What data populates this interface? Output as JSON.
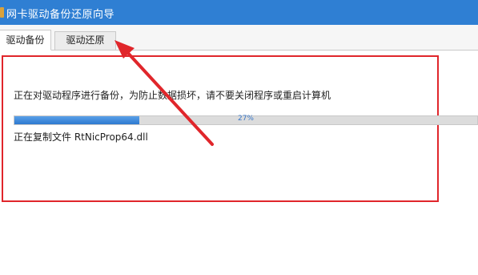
{
  "window": {
    "title": "网卡驱动备份还原向导"
  },
  "tabs": [
    {
      "label": "驱动备份",
      "active": true
    },
    {
      "label": "驱动还原",
      "active": false
    }
  ],
  "main": {
    "status_message": "正在对驱动程序进行备份，为防止数据损坏，请不要关闭程序或重启计算机",
    "progress": {
      "value": 27,
      "label": "27%"
    },
    "file_status": "正在复制文件 RtNicProp64.dll"
  },
  "annotation": {
    "color": "#e0262b",
    "arrow_target": "驱动还原"
  },
  "colors": {
    "titlebar": "#2f7fd3",
    "progress_fill": "#2d79cf"
  }
}
